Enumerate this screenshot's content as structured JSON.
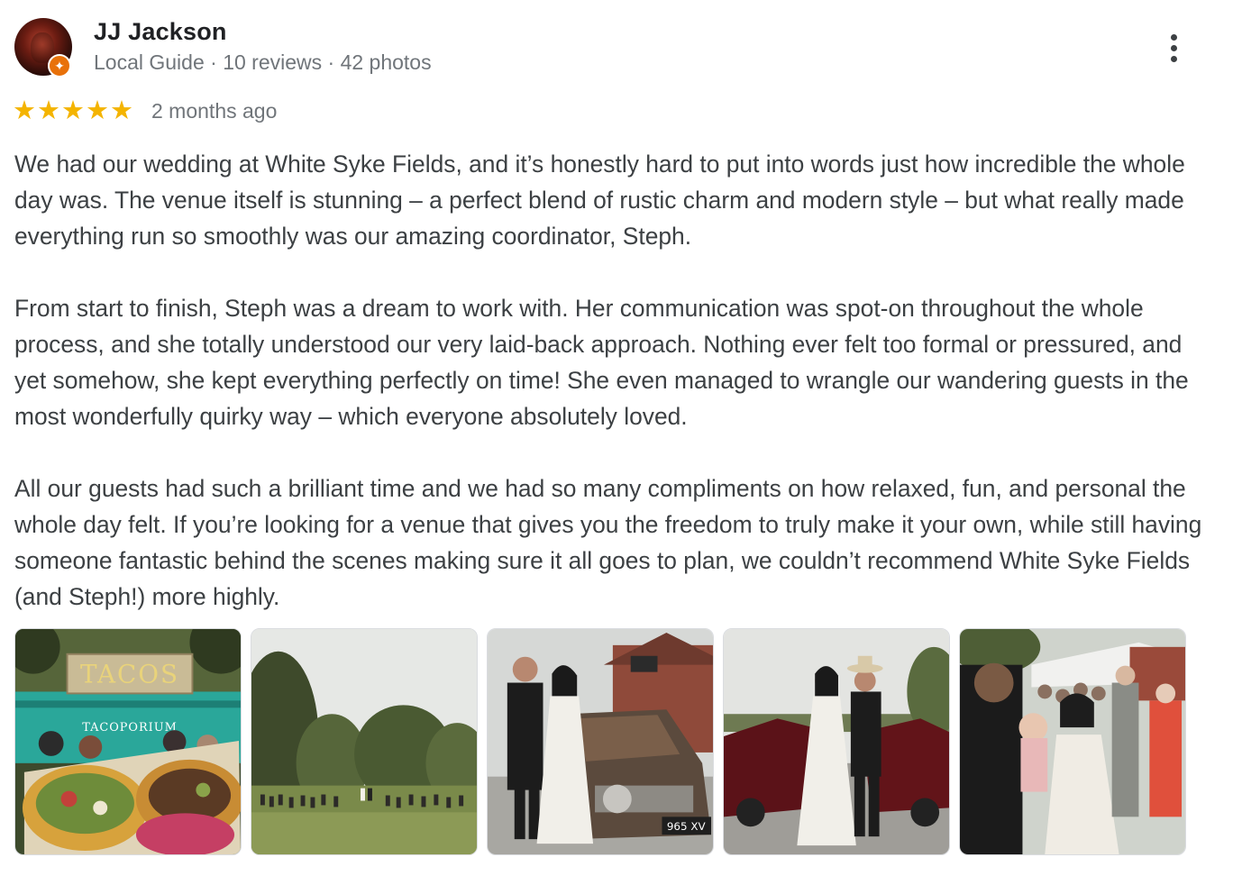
{
  "reviewer": {
    "name": "JJ Jackson",
    "meta": "Local Guide · 10 reviews · 42 photos",
    "avatar_icon": "avatar-photo",
    "badge_icon": "local-guide-badge-icon"
  },
  "rating": {
    "stars": 5,
    "star_glyph": "★",
    "time": "2 months ago",
    "star_color": "#f4b400"
  },
  "review": {
    "paragraphs": [
      "We had our wedding at White Syke Fields, and it’s honestly hard to put into words just how incredible the whole day was. The venue itself is stunning – a perfect blend of rustic charm and modern style – but what really made everything run so smoothly was our amazing coordinator, Steph.",
      "From start to finish, Steph was a dream to work with. Her communication was spot-on throughout the whole process, and she totally understood our very laid-back approach. Nothing ever felt too formal or pressured, and yet somehow, she kept everything perfectly on time! She even managed to wrangle our wandering guests in the most wonderfully quirky way – which everyone absolutely loved.",
      "All our guests had such a brilliant time and we had so many compliments on how relaxed, fun, and personal the whole day felt. If you’re looking for a venue that gives you the freedom to truly make it your own, while still having someone fantastic behind the scenes making sure it all goes to plan, we couldn’t recommend White Syke Fields (and Steph!) more highly."
    ]
  },
  "photos": {
    "items": [
      {
        "icon": "taco-truck-photo",
        "sign_text": "TACOS",
        "truck_text": "TACOPORIUM"
      },
      {
        "icon": "outdoor-ceremony-photo"
      },
      {
        "icon": "couple-with-truck-photo",
        "plate_text": "965 XV"
      },
      {
        "icon": "couple-with-red-car-photo"
      },
      {
        "icon": "couple-with-guests-photo"
      }
    ]
  },
  "colors": {
    "name": "#202124",
    "secondary": "#70757a",
    "body_text": "#3c4043",
    "badge": "#e8710a"
  }
}
